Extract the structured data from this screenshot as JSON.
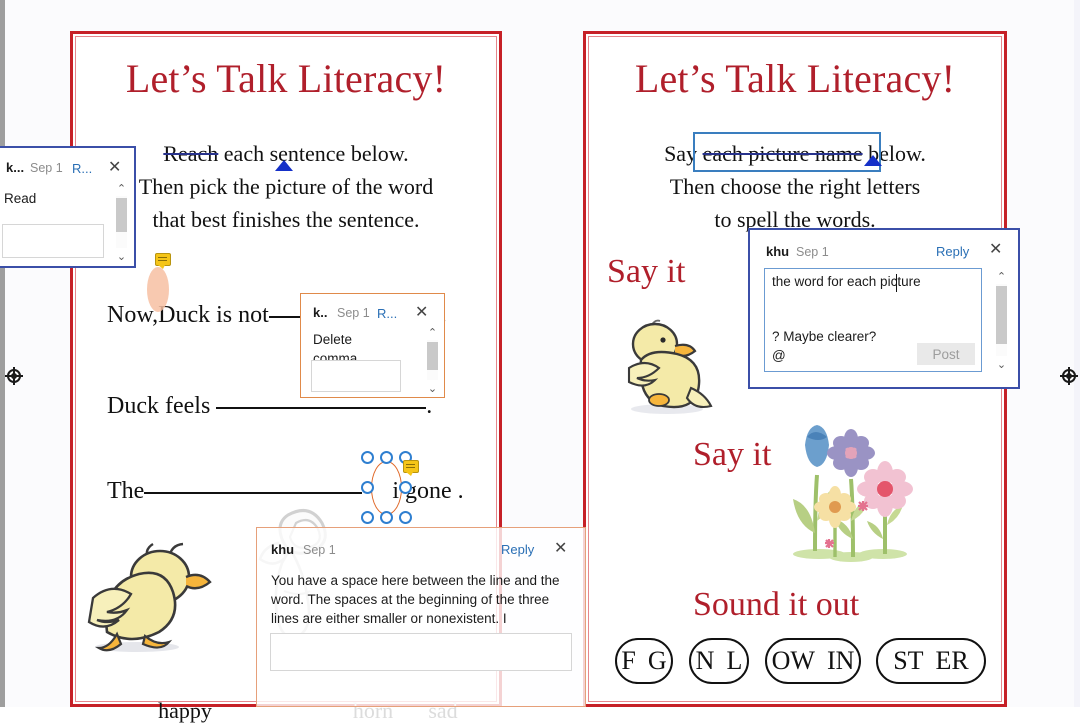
{
  "document": {
    "pages": [
      {
        "id": "left",
        "title": "Let’s Talk Literacy!",
        "instructions": [
          {
            "struck": "Reach",
            "rest": " each sentence below."
          },
          {
            "struck": "",
            "rest": "Then pick the picture of the word"
          },
          {
            "struck": "",
            "rest": "that best finishes the sentence."
          }
        ],
        "sentences": [
          {
            "before": "Now,",
            "after": "Duck is not",
            "trailing": "."
          },
          {
            "before": "",
            "after": "Duck feels",
            "trailing": "."
          },
          {
            "before": "",
            "after": "The",
            "trailing": "i  gone ."
          }
        ],
        "picture_labels": [
          "happy",
          "horn",
          "sad"
        ]
      },
      {
        "id": "right",
        "title": "Let’s Talk Literacy!",
        "instructions": [
          {
            "lead": "Say ",
            "struck": "each picture name",
            "rest": " below."
          },
          {
            "lead": "",
            "struck": "",
            "rest": "Then choose the right letters"
          },
          {
            "lead": "",
            "struck": "",
            "rest": "to spell the words."
          }
        ],
        "headings": [
          "Say it",
          "Say it",
          "Sound it out"
        ],
        "letter_pills": [
          {
            "left": "F",
            "right": "G"
          },
          {
            "left": "N",
            "right": "L"
          },
          {
            "left": "OW",
            "right": "IN"
          },
          {
            "left": "ST",
            "right": "ER"
          }
        ]
      }
    ]
  },
  "comments": [
    {
      "id": "c1",
      "author": "k...",
      "date": "Sep 1",
      "reply_label": "R...",
      "close_label": "✕",
      "body": "Read",
      "reply_value": "",
      "scroll": {
        "up": "⌃",
        "down": "⌄"
      }
    },
    {
      "id": "c2",
      "author": "k..",
      "date": "Sep 1",
      "reply_label": "R...",
      "close_label": "✕",
      "body": "Delete\ncomma",
      "reply_value": "",
      "scroll": {
        "up": "⌃",
        "down": "⌄"
      }
    },
    {
      "id": "c3",
      "author": "khu",
      "date": "Sep 1",
      "reply_label": "Reply",
      "close_label": "✕",
      "body": "You have a space here between the line and the word. The spaces at the beginning of the three lines are either smaller or nonexistent. I",
      "reply_value": "",
      "scroll": {
        "up": "",
        "down": ""
      }
    },
    {
      "id": "c4",
      "author": "khu",
      "date": "Sep 1",
      "reply_label": "Reply",
      "close_label": "✕",
      "editor_line1": "the word for each picture",
      "editor_line2": "? Maybe clearer?",
      "editor_line3": "@",
      "post_label": "Post",
      "scroll": {
        "up": "⌃",
        "down": "⌄"
      }
    }
  ],
  "markers": {
    "crosshair_icon": "crosshair-target-icon",
    "comment_balloon_icon": "comment-balloon-icon"
  },
  "colors": {
    "page_border": "#c62027",
    "page_border_inner": "#e6868c",
    "heading_red": "#b01f2b",
    "tracked_change_blue": "#1530c8",
    "selection_blue": "#3a7ebf",
    "comment_orange": "#e08a4a",
    "comment_blue": "#3b4fa8",
    "link_blue": "#2a6fb5",
    "highlight_peach": "#f7bfa2",
    "balloon_yellow": "#f5c518"
  }
}
